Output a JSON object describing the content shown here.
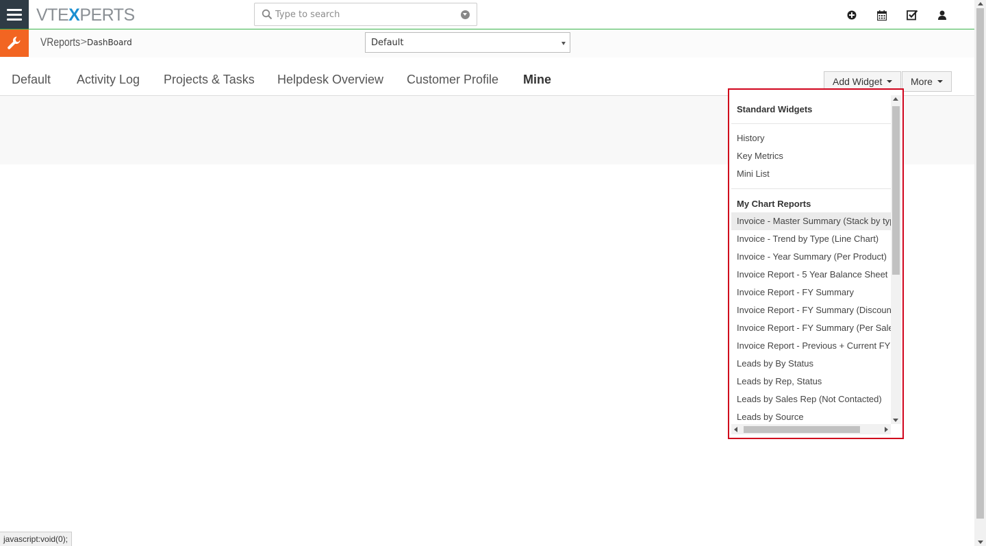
{
  "header": {
    "logo_left": "VTE",
    "logo_x": "X",
    "logo_right": "PERTS",
    "search_placeholder": "Type to search"
  },
  "breadcrumb": {
    "module": "VReports",
    "separator": ">",
    "page": "DashBoard"
  },
  "dashboard_select": {
    "value": "Default"
  },
  "tabs": [
    {
      "label": "Default"
    },
    {
      "label": "Activity Log"
    },
    {
      "label": "Projects & Tasks"
    },
    {
      "label": "Helpdesk Overview"
    },
    {
      "label": "Customer Profile"
    },
    {
      "label": "Mine",
      "active": true
    }
  ],
  "buttons": {
    "add_widget": "Add Widget",
    "more": "More"
  },
  "widget_menu": {
    "standard_header": "Standard Widgets",
    "standard_items": [
      "History",
      "Key Metrics",
      "Mini List"
    ],
    "chart_header": "My Chart Reports",
    "chart_items": [
      "Invoice - Master Summary (Stack by type)",
      "Invoice - Trend by Type (Line Chart)",
      "Invoice - Year Summary (Per Product)",
      "Invoice Report - 5 Year Balance Sheet",
      "Invoice Report - FY Summary",
      "Invoice Report - FY Summary (Discount)",
      "Invoice Report - FY Summary (Per Sales Rep)",
      "Invoice Report - Previous + Current FY",
      "Leads by By Status",
      "Leads by Rep, Status",
      "Leads by Sales Rep (Not Contacted)",
      "Leads by Source"
    ]
  },
  "statusbar": {
    "text": "javascript:void(0);"
  },
  "colors": {
    "accent_orange": "#f26522",
    "nav_dark": "#2f3b45",
    "highlight_border": "#d0021b",
    "header_rule": "#39b54a"
  }
}
